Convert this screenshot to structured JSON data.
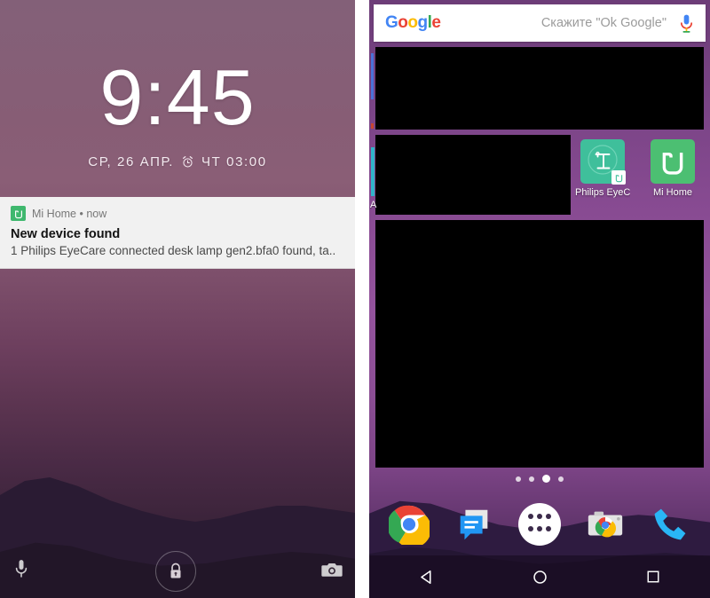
{
  "lockscreen": {
    "clock": "9:45",
    "date": "СР, 26 АПР.",
    "alarm_icon": "alarm-clock-icon",
    "alarm": "ЧТ 03:00",
    "notification": {
      "app_icon": "mi-home-icon",
      "app_line": "Mi Home • now",
      "title": "New device found",
      "body": "1 Philips EyeCare connected desk lamp gen2.bfa0 found, ta.."
    },
    "shortcuts": {
      "left_icon": "microphone-icon",
      "center_icon": "lock-icon",
      "right_icon": "camera-icon"
    }
  },
  "homescreen": {
    "search": {
      "logo": "Google",
      "logo_letters": [
        "G",
        "o",
        "o",
        "g",
        "l",
        "e"
      ],
      "hint": "Скажите \"Ok Google\"",
      "mic_icon": "microphone-icon"
    },
    "apps": [
      {
        "label": "Philips EyeC..",
        "icon": "desk-lamp-icon",
        "badge": "mi-home-icon",
        "color": "#3fbf9b"
      },
      {
        "label": "Mi Home",
        "icon": "mi-home-icon",
        "color": "#4cbf72"
      }
    ],
    "partial_label": "A",
    "page_dots": {
      "count": 4,
      "active_index": 2
    },
    "dock": [
      {
        "label": "Chrome",
        "icon": "chrome-icon"
      },
      {
        "label": "Messages",
        "icon": "messages-icon"
      },
      {
        "label": "All apps",
        "icon": "app-drawer-icon"
      },
      {
        "label": "Camera",
        "icon": "camera-icon"
      },
      {
        "label": "Phone",
        "icon": "phone-icon"
      }
    ],
    "navbar": [
      {
        "label": "Back",
        "icon": "back-triangle-icon"
      },
      {
        "label": "Home",
        "icon": "home-circle-icon"
      },
      {
        "label": "Recents",
        "icon": "recents-square-icon"
      }
    ]
  },
  "colors": {
    "pink_border": "#f5a8c0",
    "redaction": "#000000",
    "mi_home_green": "#4cbf72",
    "philips_teal": "#3fbf9b",
    "notification_bg": "#f1f1f1"
  }
}
